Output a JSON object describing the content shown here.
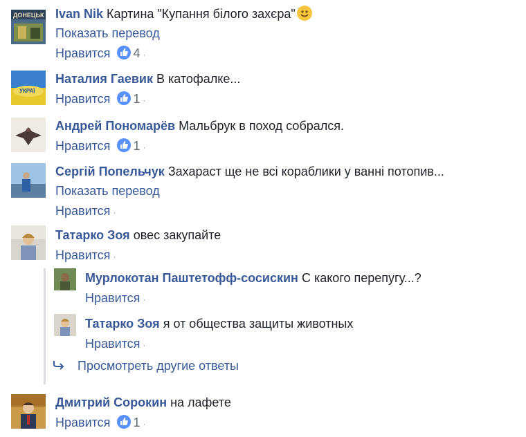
{
  "comments": [
    {
      "name": "Ivan Nik",
      "text": "Картина \"Купання білого захєра\"",
      "emoji": "smile-emoji",
      "translate": "Показать перевод",
      "like_label": "Нравится",
      "likes": "4"
    },
    {
      "name": "Наталия Гаевик",
      "text": "В катофалке...",
      "like_label": "Нравится",
      "likes": "1"
    },
    {
      "name": "Андрей Пономарёв",
      "text": "Мальбрук в поход собрался.",
      "like_label": "Нравится",
      "likes": "1"
    },
    {
      "name": "Сергій Попельчук",
      "text": "Захараст ще не всі кораблики у ванні потопив...",
      "translate": "Показать перевод",
      "like_label": "Нравится"
    },
    {
      "name": "Татарко Зоя",
      "text": "овес закупайте",
      "like_label": "Нравится"
    },
    {
      "name": "Дмитрий Сорокин",
      "text": "на лафете",
      "like_label": "Нравится",
      "likes": "1"
    }
  ],
  "replies": [
    {
      "name": "Мурлокотан Паштетофф-сосискин",
      "text": "С какого перепугу...?",
      "like_label": "Нравится"
    },
    {
      "name": "Татарко Зоя",
      "text": "я от общества защиты животных",
      "like_label": "Нравится"
    }
  ],
  "more_replies_label": "Просмотреть другие ответы",
  "icons": {
    "like": "thumbs-up-icon",
    "reply_arrow": "reply-arrow-icon"
  },
  "colors": {
    "link": "#385898",
    "like_badge": "#5890ff",
    "meta": "#616770"
  }
}
